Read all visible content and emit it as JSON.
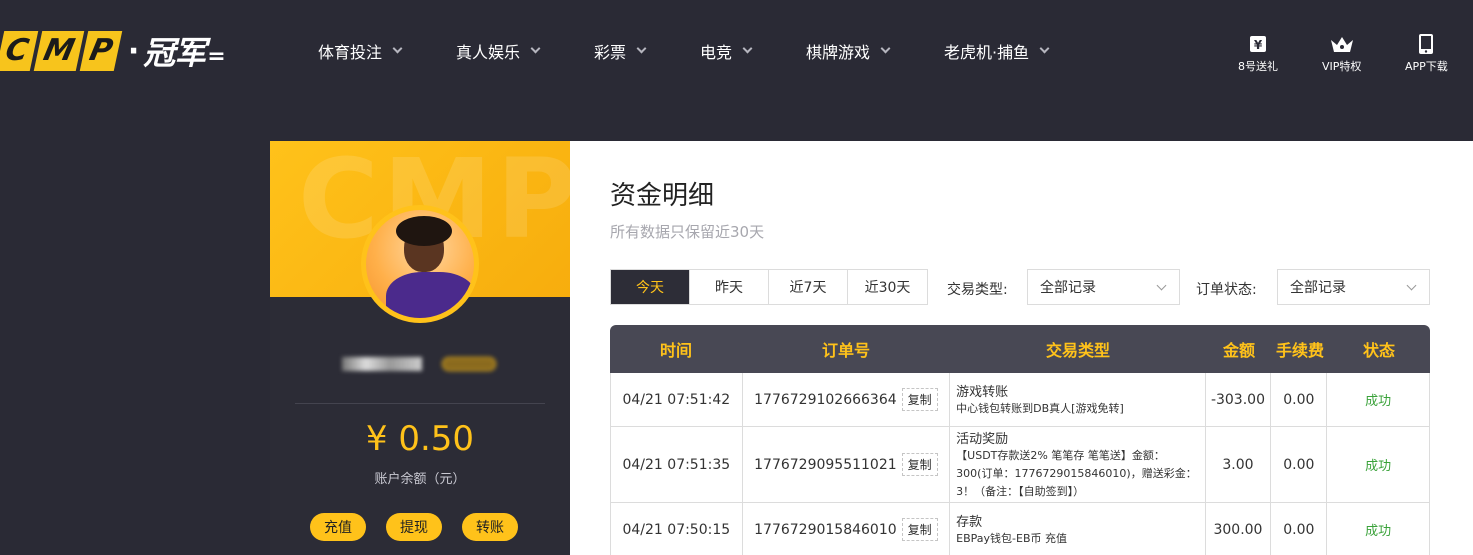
{
  "logo": {
    "letters": [
      "C",
      "M",
      "P"
    ],
    "dot": "·",
    "brand": "冠军"
  },
  "nav": {
    "items": [
      {
        "label": "体育投注"
      },
      {
        "label": "真人娱乐"
      },
      {
        "label": "彩票"
      },
      {
        "label": "电竞"
      },
      {
        "label": "棋牌游戏"
      },
      {
        "label": "老虎机·捕鱼"
      }
    ]
  },
  "tools": {
    "gift": {
      "label": "8号送礼",
      "icon": "gift-icon"
    },
    "vip": {
      "label": "VIP特权",
      "icon": "crown-icon"
    },
    "app": {
      "label": "APP下载",
      "icon": "phone-icon"
    }
  },
  "profile": {
    "banner_text": "CMP",
    "balance": "¥ 0.50",
    "balance_label": "账户余额（元）",
    "buttons": {
      "deposit": "充值",
      "withdraw": "提现",
      "transfer": "转账"
    }
  },
  "page": {
    "title": "资金明细",
    "subtitle": "所有数据只保留近30天"
  },
  "filters": {
    "ranges": [
      {
        "label": "今天",
        "active": true
      },
      {
        "label": "昨天",
        "active": false
      },
      {
        "label": "近7天",
        "active": false
      },
      {
        "label": "近30天",
        "active": false
      }
    ],
    "type_label": "交易类型:",
    "type_value": "全部记录",
    "status_label": "订单状态:",
    "status_value": "全部记录"
  },
  "table": {
    "headers": {
      "time": "时间",
      "order": "订单号",
      "type": "交易类型",
      "amount": "金额",
      "fee": "手续费",
      "status": "状态"
    },
    "copy_label": "复制",
    "rows": [
      {
        "time": "04/21 07:51:42",
        "order": "1776729102666364",
        "type_title": "游戏转账",
        "type_desc": "中心钱包转账到DB真人[游戏免转]",
        "amount": "-303.00",
        "fee": "0.00",
        "status": "成功"
      },
      {
        "time": "04/21 07:51:35",
        "order": "1776729095511021",
        "type_title": "活动奖励",
        "type_desc": "【USDT存款送2% 笔笔存 笔笔送】金额：300(订单：1776729015846010)，赠送彩金：3！（备注：【自助签到】）",
        "amount": "3.00",
        "fee": "0.00",
        "status": "成功"
      },
      {
        "time": "04/21 07:50:15",
        "order": "1776729015846010",
        "type_title": "存款",
        "type_desc": "EBPay钱包-EB币 充值",
        "amount": "300.00",
        "fee": "0.00",
        "status": "成功"
      }
    ]
  },
  "colors": {
    "accent": "#ffc21a",
    "dark": "#2a2a35",
    "success": "#3aa23a",
    "table_head": "#484854"
  }
}
